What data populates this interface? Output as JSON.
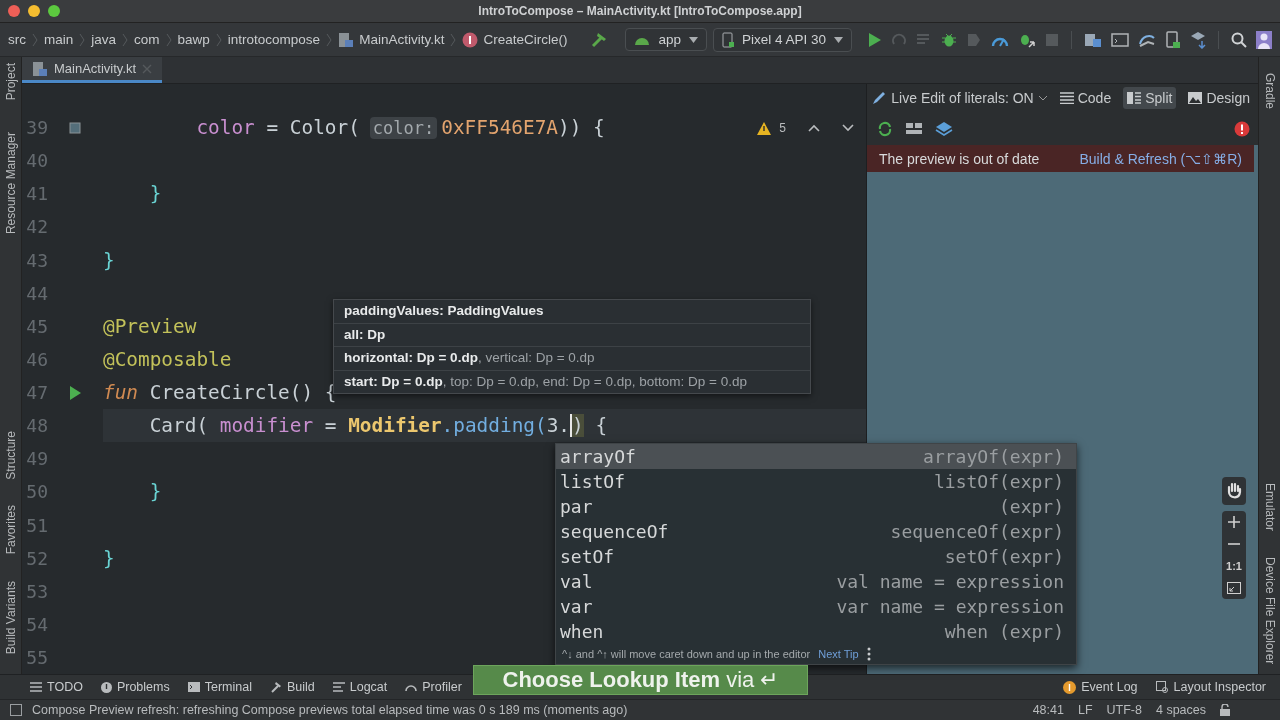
{
  "window": {
    "title": "IntroToCompose – MainActivity.kt [IntroToCompose.app]"
  },
  "breadcrumbs": [
    {
      "label": "src",
      "kind": "folder"
    },
    {
      "label": "main",
      "kind": "folder"
    },
    {
      "label": "java",
      "kind": "folder"
    },
    {
      "label": "com",
      "kind": "folder"
    },
    {
      "label": "bawp",
      "kind": "folder"
    },
    {
      "label": "introtocompose",
      "kind": "folder"
    },
    {
      "label": "MainActivity.kt",
      "kind": "file"
    },
    {
      "label": "CreateCircle()",
      "kind": "function"
    }
  ],
  "run_config": {
    "module": "app",
    "device": "Pixel 4 API 30"
  },
  "left_stripe": {
    "top": [
      "Project",
      "Resource Manager"
    ],
    "bottom": [
      "Structure",
      "Favorites",
      "Build Variants"
    ]
  },
  "right_stripe": {
    "top": [
      "Gradle"
    ],
    "bottom": [
      "Emulator",
      "Device File Explorer"
    ]
  },
  "tabs": [
    {
      "label": "MainActivity.kt",
      "selected": true
    }
  ],
  "inspection": {
    "count": "5"
  },
  "code_lines": [
    {
      "number": "39",
      "kind": "swatch",
      "tokens": [
        {
          "text": "        color",
          "kind": "property"
        },
        {
          "text": " = Color(",
          "kind": "plain"
        },
        {
          "text": "color:",
          "kind": "hint"
        },
        {
          "text": "0xFF546E7A",
          "kind": "number"
        },
        {
          "text": ")) {",
          "kind": "plain"
        }
      ]
    },
    {
      "number": "40",
      "kind": "plain"
    },
    {
      "number": "41",
      "kind": "plain",
      "tokens": [
        {
          "text": "    }",
          "kind": "brace"
        }
      ]
    },
    {
      "number": "42",
      "kind": "plain"
    },
    {
      "number": "43",
      "kind": "plain",
      "tokens": [
        {
          "text": "}",
          "kind": "brace"
        }
      ]
    },
    {
      "number": "44",
      "kind": "plain"
    },
    {
      "number": "45",
      "kind": "plain",
      "tokens": [
        {
          "text": "@Preview",
          "kind": "annotation"
        }
      ]
    },
    {
      "number": "46",
      "kind": "plain",
      "tokens": [
        {
          "text": "@Composable",
          "kind": "annotation"
        }
      ]
    },
    {
      "number": "47",
      "kind": "run",
      "tokens": [
        {
          "text": "fun",
          "kind": "keyword"
        },
        {
          "text": " CreateCircle() {",
          "kind": "plain"
        }
      ]
    },
    {
      "number": "48",
      "kind": "plain",
      "current": true,
      "tokens": [
        {
          "text": "    Card(",
          "kind": "plain"
        },
        {
          "text": " modifier",
          "kind": "property"
        },
        {
          "text": " = ",
          "kind": "plain"
        },
        {
          "text": "Modifier",
          "kind": "class"
        },
        {
          "text": ".padding(",
          "kind": "call"
        },
        {
          "text": "3.",
          "kind": "plain"
        },
        {
          "text": ")",
          "kind": "plain",
          "caret": true
        },
        {
          "text": " {",
          "kind": "plain"
        }
      ]
    },
    {
      "number": "49",
      "kind": "plain"
    },
    {
      "number": "50",
      "kind": "plain",
      "tokens": [
        {
          "text": "    }",
          "kind": "brace"
        }
      ]
    },
    {
      "number": "51",
      "kind": "plain"
    },
    {
      "number": "52",
      "kind": "plain",
      "tokens": [
        {
          "text": "}",
          "kind": "brace"
        }
      ]
    },
    {
      "number": "53",
      "kind": "plain"
    },
    {
      "number": "54",
      "kind": "plain"
    },
    {
      "number": "55",
      "kind": "plain"
    }
  ],
  "parameter_info": [
    {
      "text": "**paddingValues: PaddingValues**"
    },
    {
      "text": "**all: Dp**"
    },
    {
      "text": "**horizontal: Dp = 0.dp**, vertical: Dp = 0.dp"
    },
    {
      "text": "**start: Dp = 0.dp**, top: Dp = 0.dp, end: Dp = 0.dp, bottom: Dp = 0.dp"
    }
  ],
  "completion": {
    "items": [
      {
        "name": "arrayOf",
        "detail": "arrayOf(expr)",
        "selected": true
      },
      {
        "name": "listOf",
        "detail": "listOf(expr)",
        "selected": false
      },
      {
        "name": "par",
        "detail": "(expr)",
        "selected": false
      },
      {
        "name": "sequenceOf",
        "detail": "sequenceOf(expr)",
        "selected": false
      },
      {
        "name": "setOf",
        "detail": "setOf(expr)",
        "selected": false
      },
      {
        "name": "val",
        "detail": "val name = expression",
        "selected": false
      },
      {
        "name": "var",
        "detail": "var name = expression",
        "selected": false
      },
      {
        "name": "when",
        "detail": "when (expr)",
        "selected": false
      }
    ],
    "hint": "^↓ and ^↑ will move caret down and up in the editor",
    "link": "Next Tip"
  },
  "preview": {
    "live_edit": "Live Edit of literals: ON",
    "modes": [
      {
        "label": "Code",
        "selected": false
      },
      {
        "label": "Split",
        "selected": true
      },
      {
        "label": "Design",
        "selected": false
      }
    ],
    "banner": "The preview is out of date",
    "banner_link": "Build & Refresh (⌥⇧⌘R)",
    "zoom": [
      "1:1"
    ]
  },
  "tool_windows": {
    "left": [
      "TODO",
      "Problems",
      "Terminal",
      "Build",
      "Logcat",
      "Profiler"
    ],
    "right": [
      "Event Log",
      "Layout Inspector"
    ]
  },
  "key_promoter": "**Choose Lookup Item** via ↵",
  "status_bar": {
    "message": "Compose Preview refresh: refreshing Compose previews total elapsed time was 0 s 189 ms (moments ago)",
    "items": [
      "48:41",
      "LF",
      "UTF-8",
      "4 spaces"
    ]
  }
}
